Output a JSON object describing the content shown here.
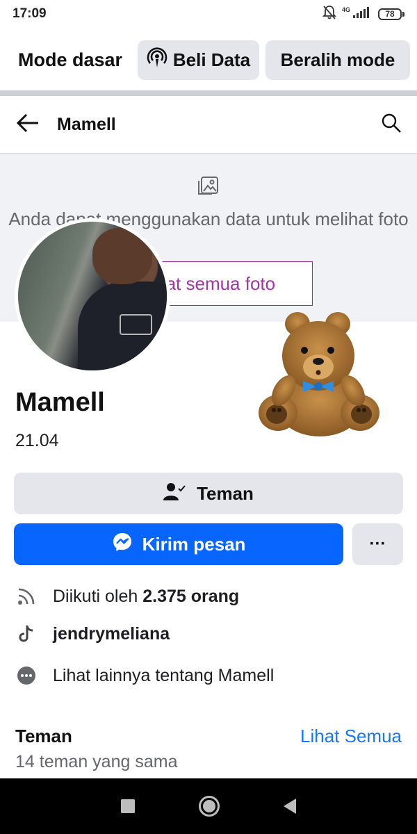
{
  "status_bar": {
    "time": "17:09",
    "network": "4G",
    "battery": "78",
    "icons": [
      "bell-off-icon",
      "signal-icon",
      "battery-icon"
    ]
  },
  "mode_bar": {
    "title": "Mode dasar",
    "buy_data_label": "Beli Data",
    "switch_mode_label": "Beralih mode"
  },
  "top_nav": {
    "title": "Mamell"
  },
  "cover": {
    "message": "Anda dapat menggunakan data untuk melihat foto",
    "button_label": "Lihat semua foto"
  },
  "profile": {
    "name": "Mamell",
    "bio": "21.04"
  },
  "actions": {
    "friend_label": "Teman",
    "message_label": "Kirim pesan",
    "more_label": "···"
  },
  "info": {
    "followers_prefix": "Diikuti oleh ",
    "followers_count": "2.375 orang",
    "tiktok": "jendrymeliana",
    "see_more": "Lihat lainnya tentang Mamell"
  },
  "friends": {
    "title": "Teman",
    "see_all": "Lihat Semua",
    "mutual": "14 teman yang sama"
  },
  "colors": {
    "primary_blue": "#0866ff",
    "link_blue": "#1877f2",
    "cover_bg": "#f0f2f5",
    "button_gray": "#e4e6eb",
    "cover_button_text": "#a137a5"
  }
}
